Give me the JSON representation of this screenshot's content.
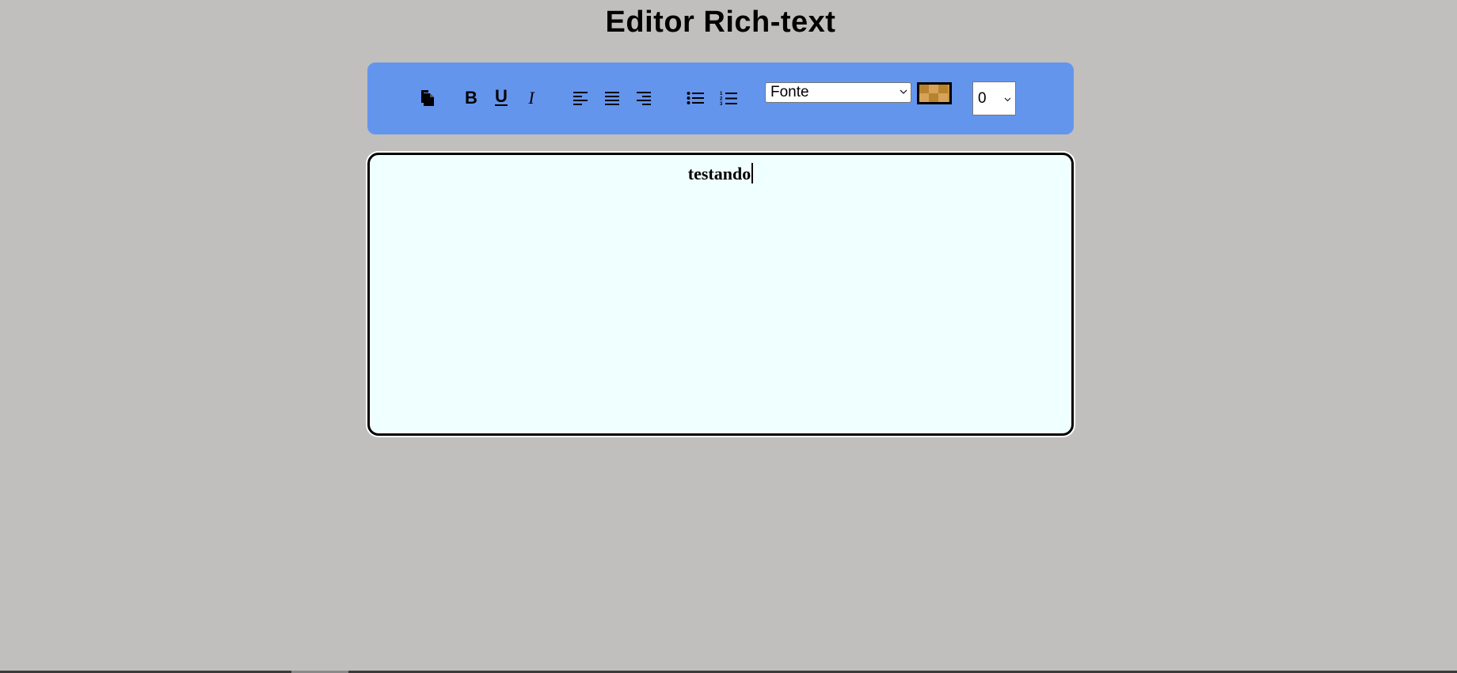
{
  "page": {
    "title": "Editor Rich-text",
    "background_color": "#c0bfbd"
  },
  "toolbar": {
    "background_color": "#6495ed",
    "buttons": {
      "copy": {
        "icon": "copy-icon"
      },
      "bold": {
        "label": "B",
        "icon": "bold-icon"
      },
      "underline": {
        "label": "U",
        "icon": "underline-icon"
      },
      "italic": {
        "label": "I",
        "icon": "italic-icon"
      },
      "align_left": {
        "icon": "align-left-icon"
      },
      "align_center": {
        "icon": "align-justify-icon"
      },
      "align_right": {
        "icon": "align-right-icon"
      },
      "bullet_list": {
        "icon": "unordered-list-icon"
      },
      "numbered_list": {
        "icon": "ordered-list-icon"
      }
    },
    "font_select": {
      "selected": "Fonte"
    },
    "color_picker": {
      "swatch_color": "#c8943f",
      "border_color": "#000000"
    },
    "size_select": {
      "selected": "0"
    }
  },
  "editor": {
    "content": "testando",
    "background_color": "#f0ffff",
    "text_align": "center",
    "text_weight": "bold"
  }
}
